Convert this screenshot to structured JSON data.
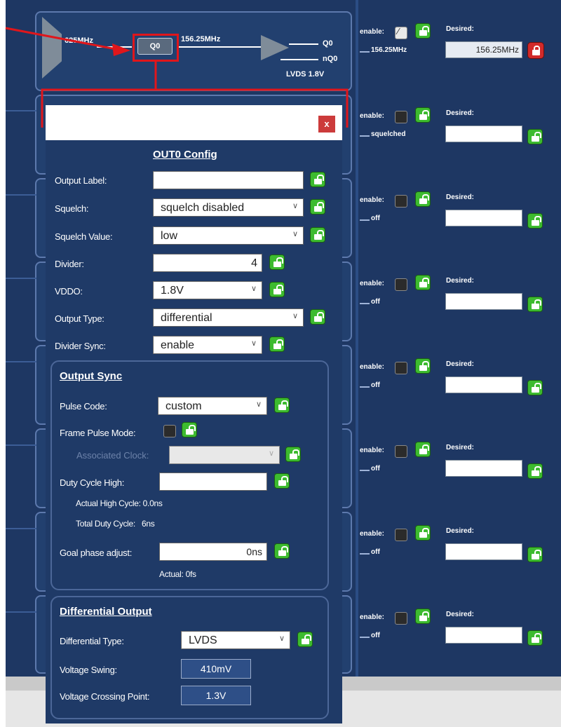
{
  "block_diagram": {
    "input_freq": "625MHz",
    "divider_label": "Q0",
    "output_freq": "156.25MHz",
    "out_pos": "Q0",
    "out_neg": "nQ0",
    "out_type": "LVDS 1.8V"
  },
  "right_panel": {
    "enable_label": "enable:",
    "desired_label": "Desired:",
    "rows": [
      {
        "status": "156.25MHz",
        "desired": "156.25MHz",
        "enabled": true
      },
      {
        "status": "squelched",
        "desired": "",
        "enabled": false
      },
      {
        "status": "off",
        "desired": "",
        "enabled": false
      },
      {
        "status": "off",
        "desired": "",
        "enabled": false
      },
      {
        "status": "off",
        "desired": "",
        "enabled": false
      },
      {
        "status": "off",
        "desired": "",
        "enabled": false
      },
      {
        "status": "off",
        "desired": "",
        "enabled": false
      },
      {
        "status": "off",
        "desired": "",
        "enabled": false
      }
    ]
  },
  "dialog": {
    "close": "x",
    "title": "OUT0 Config",
    "output_label": {
      "label": "Output Label:",
      "value": ""
    },
    "squelch": {
      "label": "Squelch:",
      "value": "squelch disabled"
    },
    "squelch_value": {
      "label": "Squelch Value:",
      "value": "low"
    },
    "divider": {
      "label": "Divider:",
      "value": "4"
    },
    "vddo": {
      "label": "VDDO:",
      "value": "1.8V"
    },
    "output_type": {
      "label": "Output Type:",
      "value": "differential"
    },
    "divider_sync": {
      "label": "Divider Sync:",
      "value": "enable"
    },
    "output_sync": {
      "title": "Output Sync",
      "pulse_code": {
        "label": "Pulse Code:",
        "value": "custom"
      },
      "frame_pulse_mode": {
        "label": "Frame Pulse Mode:"
      },
      "associated_clock": {
        "label": "Associated Clock:"
      },
      "duty_cycle_high": {
        "label": "Duty Cycle High:",
        "value": ""
      },
      "actual_high_cycle": "Actual High Cycle: 0.0ns",
      "total_duty_cycle": "Total Duty Cycle:   6ns",
      "goal_phase": {
        "label": "Goal phase adjust:",
        "value": "0ns"
      },
      "actual": "Actual: 0fs"
    },
    "differential_output": {
      "title": "Differential Output",
      "type": {
        "label": "Differential Type:",
        "value": "LVDS"
      },
      "voltage_swing": {
        "label": "Voltage Swing:",
        "value": "410mV"
      },
      "crossing": {
        "label": "Voltage Crossing Point:",
        "value": "1.3V"
      }
    }
  },
  "colors": {
    "highlight": "#e0161b",
    "lock_green": "#3dbb2f",
    "lock_red": "#d12a2a",
    "panel": "#1e3763"
  }
}
